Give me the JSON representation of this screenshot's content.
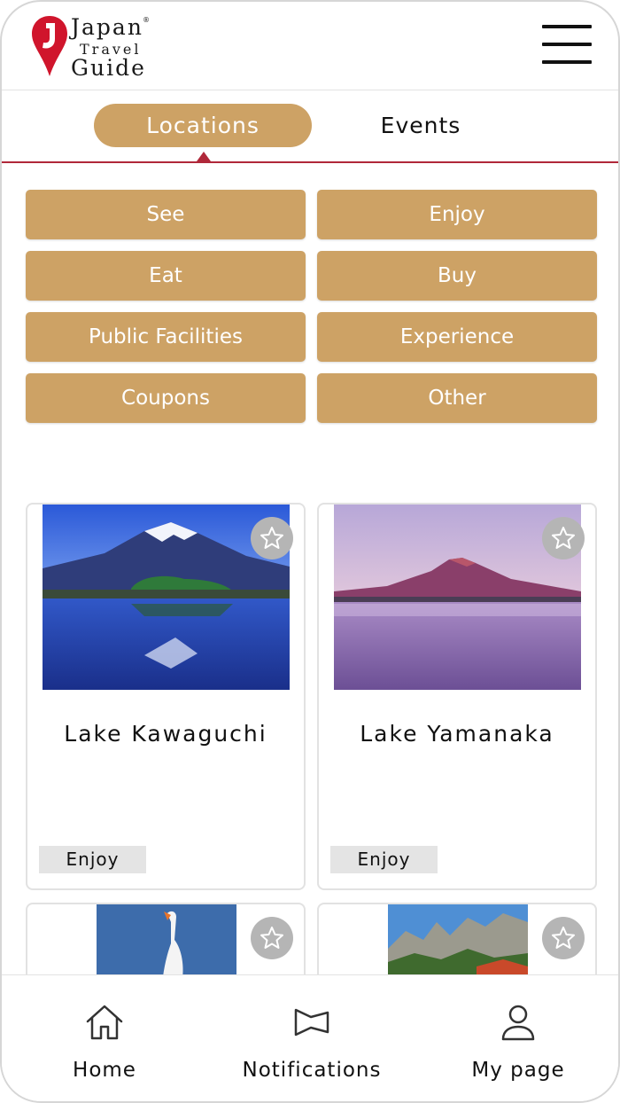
{
  "app": {
    "logo": {
      "line1": "Japan",
      "line2": "Travel",
      "line3": "Guide",
      "reg": "®"
    },
    "menu_icon": "hamburger-icon",
    "accent_color": "#cda265",
    "divider_color": "#b0283a"
  },
  "tabs": [
    {
      "label": "Locations",
      "active": true
    },
    {
      "label": "Events",
      "active": false
    }
  ],
  "categories": [
    {
      "label": "See"
    },
    {
      "label": "Enjoy"
    },
    {
      "label": "Eat"
    },
    {
      "label": "Buy"
    },
    {
      "label": "Public Facilities"
    },
    {
      "label": "Experience"
    },
    {
      "label": "Coupons"
    },
    {
      "label": "Other"
    }
  ],
  "cards": [
    {
      "title": "Lake Kawaguchi",
      "tag": "Enjoy",
      "favorite_icon": "star-outline-icon"
    },
    {
      "title": "Lake Yamanaka",
      "tag": "Enjoy",
      "favorite_icon": "star-outline-icon"
    },
    {
      "title": "",
      "tag": "",
      "favorite_icon": "star-outline-icon"
    },
    {
      "title": "",
      "tag": "",
      "favorite_icon": "star-outline-icon"
    }
  ],
  "bottom_nav": [
    {
      "label": "Home",
      "icon": "home-icon"
    },
    {
      "label": "Notifications",
      "icon": "megaphone-icon"
    },
    {
      "label": "My page",
      "icon": "user-icon"
    }
  ]
}
